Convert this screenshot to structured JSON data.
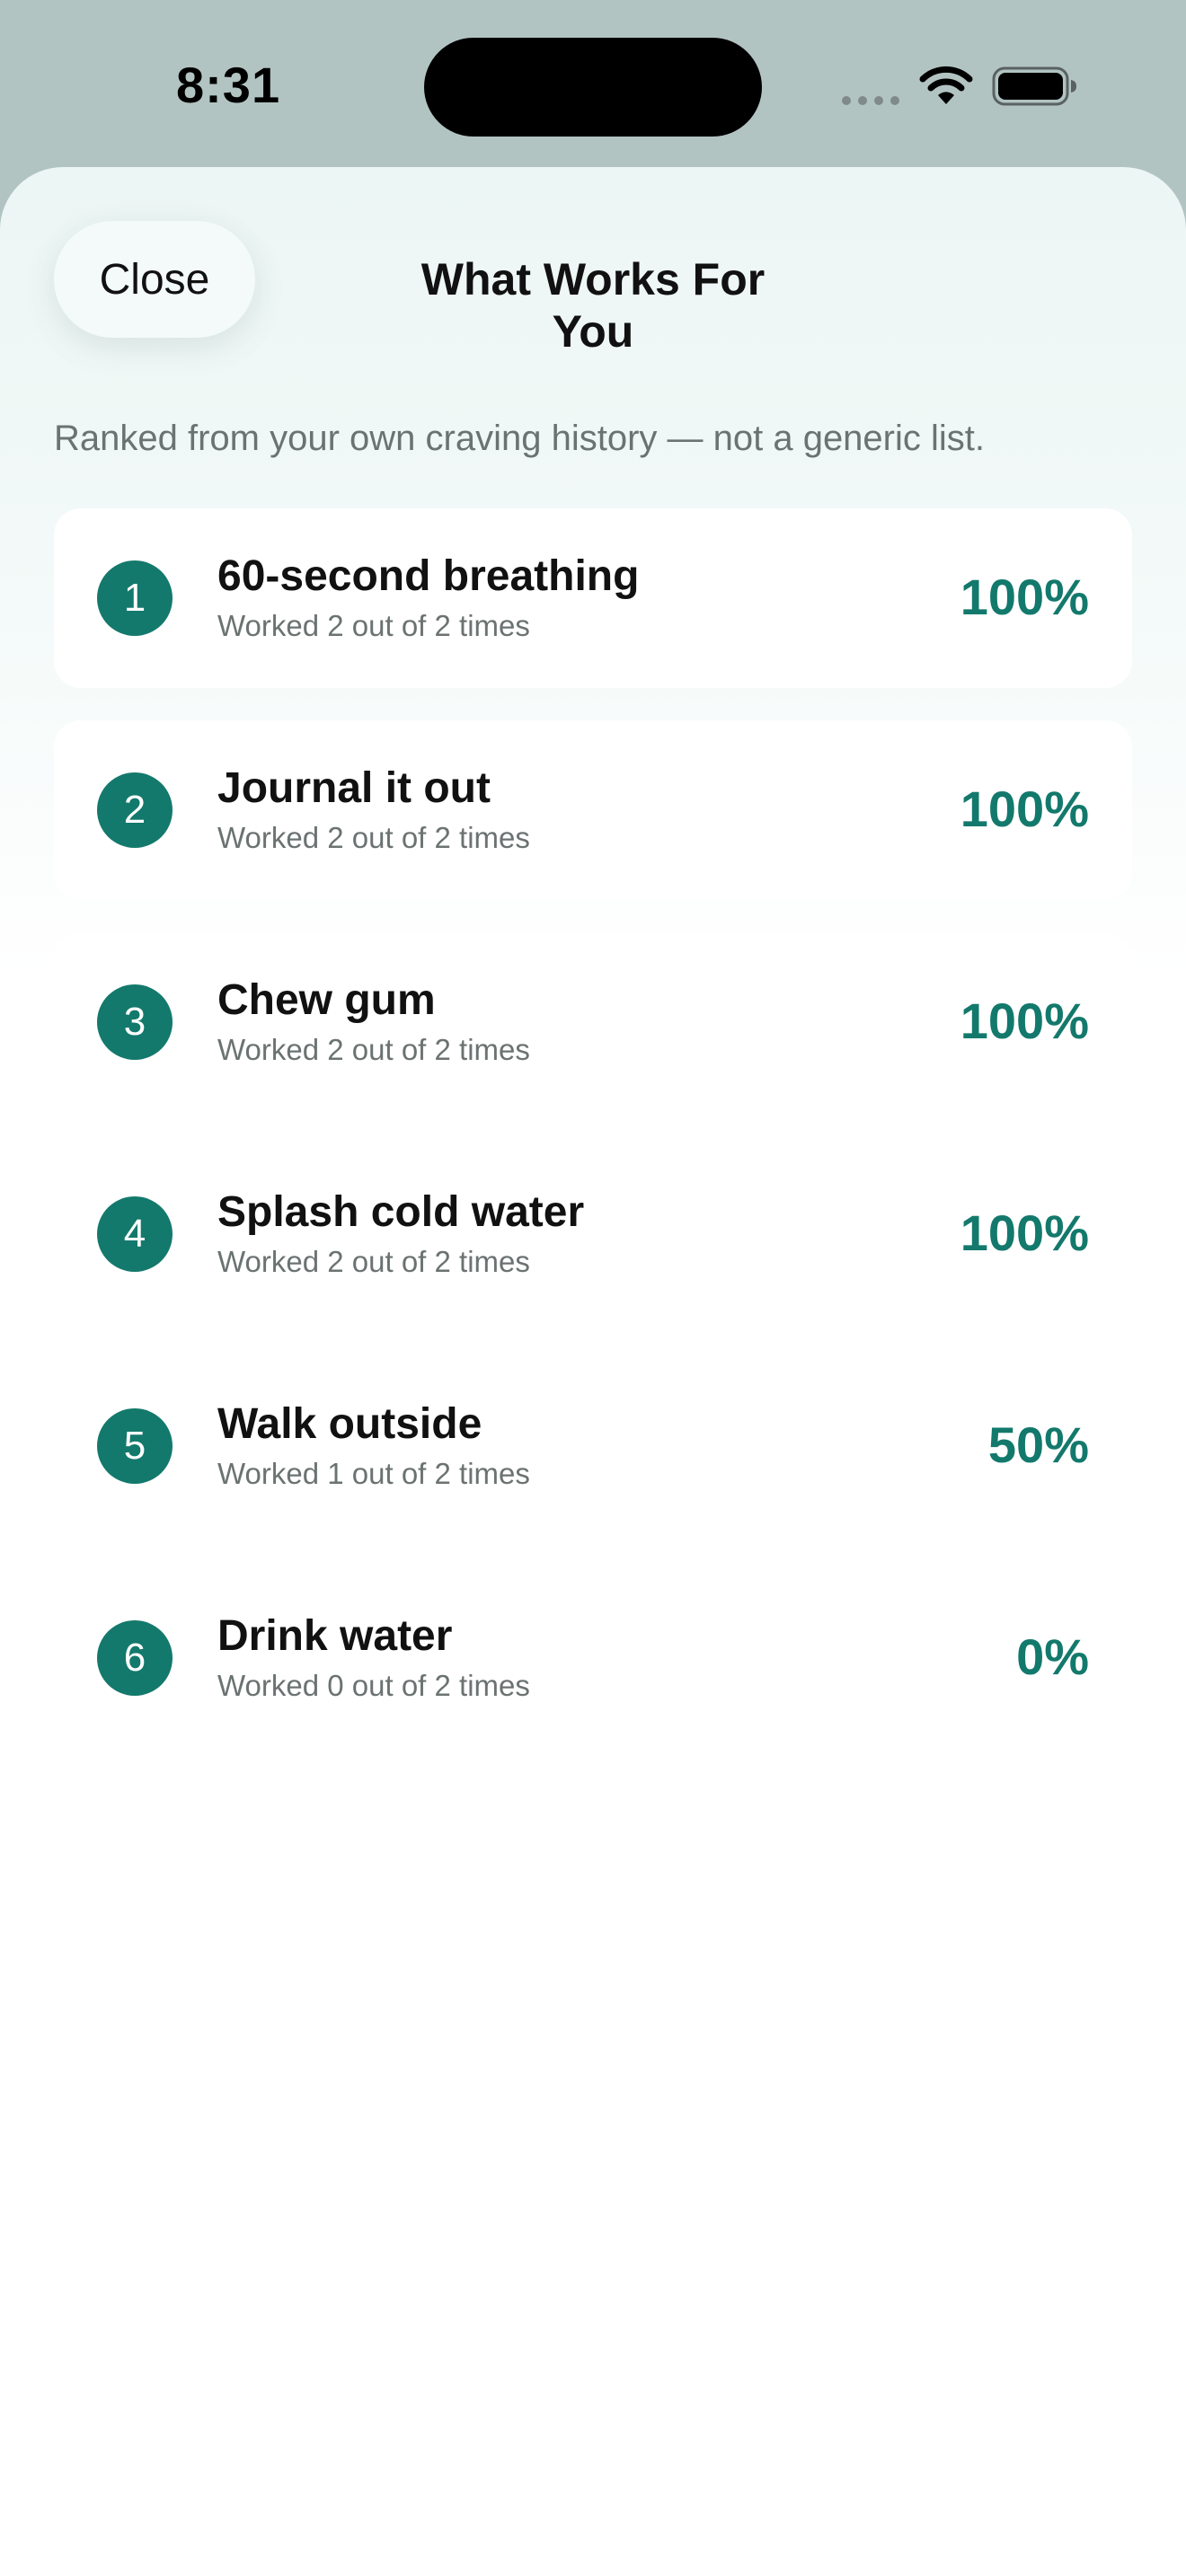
{
  "status_bar": {
    "time": "8:31"
  },
  "header": {
    "close_label": "Close",
    "title": "What Works For You"
  },
  "subtitle": "Ranked from your own craving history — not a generic list.",
  "items": [
    {
      "rank": "1",
      "name": "60-second breathing",
      "detail": "Worked 2 out of 2 times",
      "percent": "100%"
    },
    {
      "rank": "2",
      "name": "Journal it out",
      "detail": "Worked 2 out of 2 times",
      "percent": "100%"
    },
    {
      "rank": "3",
      "name": "Chew gum",
      "detail": "Worked 2 out of 2 times",
      "percent": "100%"
    },
    {
      "rank": "4",
      "name": "Splash cold water",
      "detail": "Worked 2 out of 2 times",
      "percent": "100%"
    },
    {
      "rank": "5",
      "name": "Walk outside",
      "detail": "Worked 1 out of 2 times",
      "percent": "50%"
    },
    {
      "rank": "6",
      "name": "Drink water",
      "detail": "Worked 0 out of 2 times",
      "percent": "0%"
    }
  ],
  "colors": {
    "accent": "#13796c",
    "status_bar_bg": "#b2c4c2",
    "secondary_text": "#6b7372"
  },
  "icons": [
    "signal-icon",
    "wifi-icon",
    "battery-icon"
  ]
}
